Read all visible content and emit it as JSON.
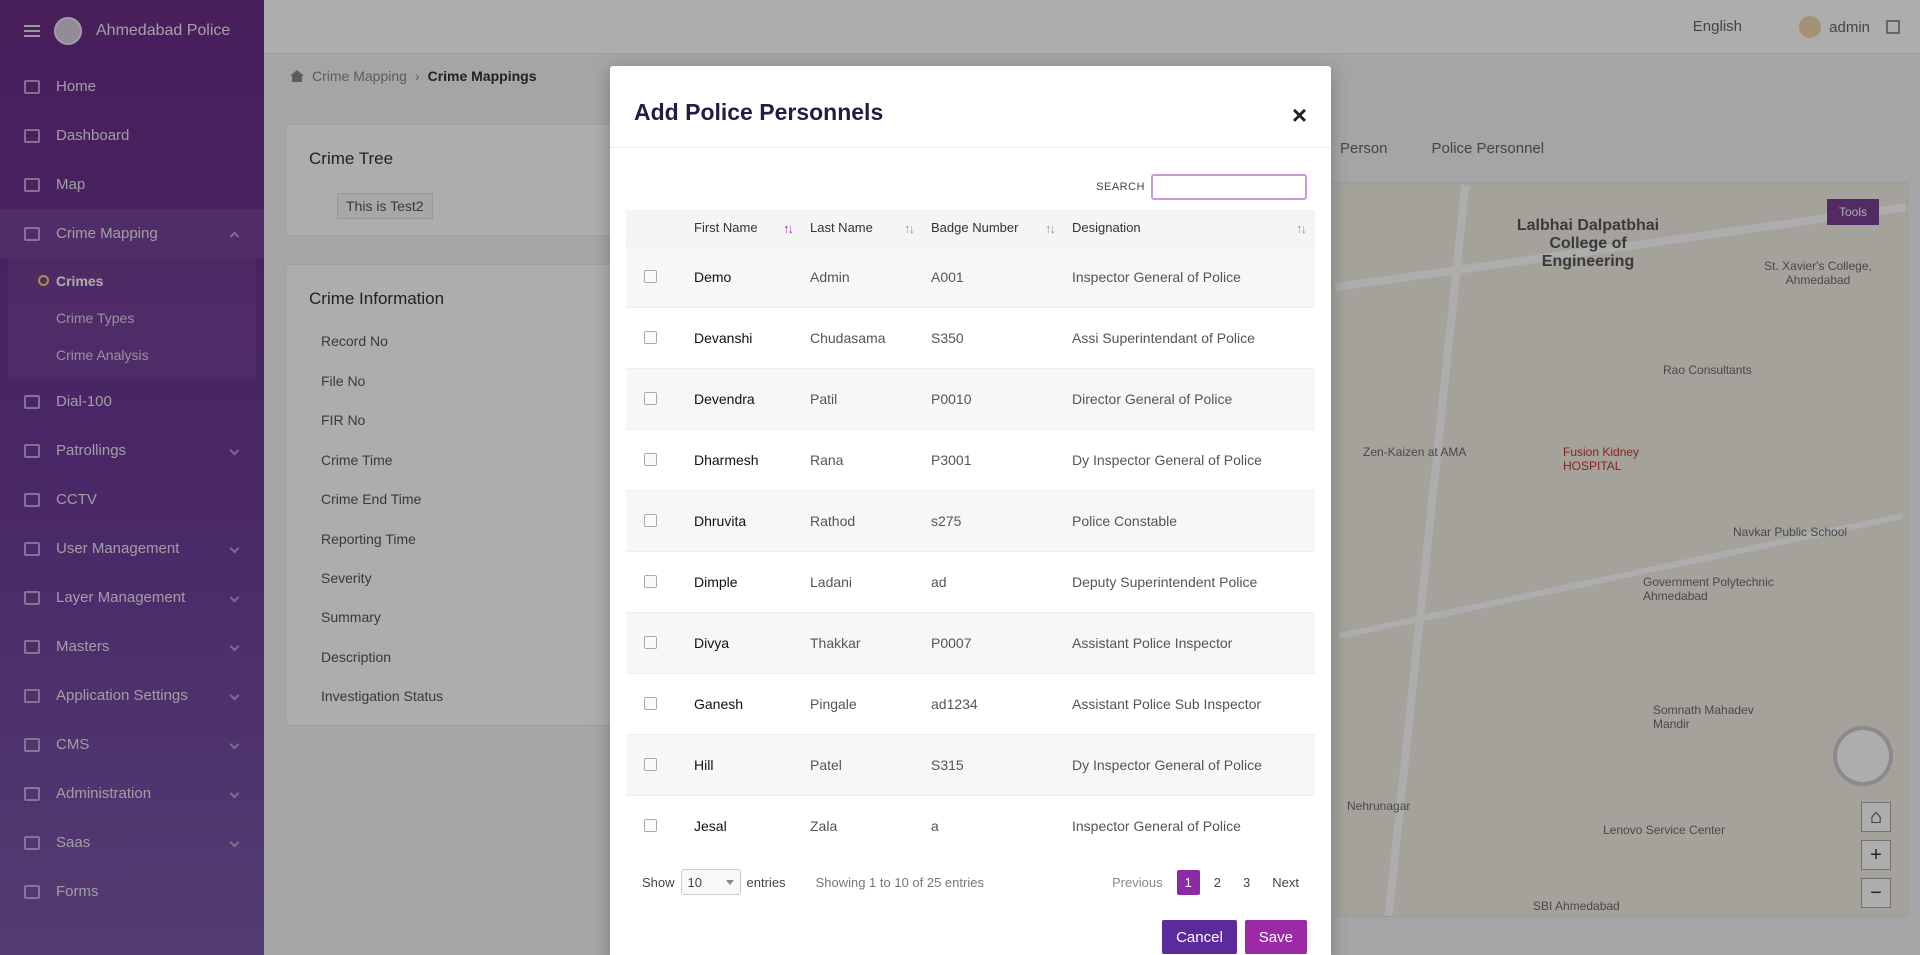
{
  "app": {
    "title": "Ahmedabad Police"
  },
  "sidebar": {
    "items": [
      {
        "label": "Home"
      },
      {
        "label": "Dashboard"
      },
      {
        "label": "Map"
      },
      {
        "label": "Crime Mapping"
      },
      {
        "label": "Dial-100"
      },
      {
        "label": "Patrollings"
      },
      {
        "label": "CCTV"
      },
      {
        "label": "User Management"
      },
      {
        "label": "Layer Management"
      },
      {
        "label": "Masters"
      },
      {
        "label": "Application Settings"
      },
      {
        "label": "CMS"
      },
      {
        "label": "Administration"
      },
      {
        "label": "Saas"
      },
      {
        "label": "Forms"
      }
    ],
    "sub_items": [
      {
        "label": "Crimes"
      },
      {
        "label": "Crime Types"
      },
      {
        "label": "Crime Analysis"
      }
    ]
  },
  "topbar": {
    "language": "English",
    "user": "admin"
  },
  "breadcrumb": {
    "parent": "Crime Mapping",
    "current": "Crime Mappings"
  },
  "crime_tree": {
    "title": "Crime Tree",
    "node": "This is Test2"
  },
  "crime_info": {
    "title": "Crime Information",
    "fields": [
      "Record No",
      "File No",
      "FIR No",
      "Crime Time",
      "Crime End Time",
      "Reporting Time",
      "Severity",
      "Summary",
      "Description",
      "Investigation Status"
    ]
  },
  "tabs": [
    "Person",
    "Police Personnel"
  ],
  "map": {
    "tools": "Tools",
    "labels": [
      "Lalbhai Dalpatbhai College of Engineering",
      "St. Xavier's College, Ahmedabad",
      "Rao Consultants",
      "Zen-Kaizen at AMA",
      "Fusion Kidney HOSPITAL",
      "Navkar Public School",
      "Government Polytechnic Ahmedabad",
      "Somnath Mahadev Mandir",
      "Nehrunagar",
      "Lenovo Service Center",
      "SBI Ahmedabad"
    ]
  },
  "modal": {
    "title": "Add Police Personnels",
    "search_label": "SEARCH",
    "columns": [
      "First Name",
      "Last Name",
      "Badge Number",
      "Designation"
    ],
    "rows": [
      {
        "first": "Demo",
        "last": "Admin",
        "badge": "A001",
        "designation": "Inspector General of Police"
      },
      {
        "first": "Devanshi",
        "last": "Chudasama",
        "badge": "S350",
        "designation": "Assi Superintendant of Police"
      },
      {
        "first": "Devendra",
        "last": "Patil",
        "badge": "P0010",
        "designation": "Director General of Police"
      },
      {
        "first": "Dharmesh",
        "last": "Rana",
        "badge": "P3001",
        "designation": "Dy Inspector General of Police"
      },
      {
        "first": "Dhruvita",
        "last": "Rathod",
        "badge": "s275",
        "designation": "Police Constable"
      },
      {
        "first": "Dimple",
        "last": "Ladani",
        "badge": "ad",
        "designation": "Deputy Superintendent Police"
      },
      {
        "first": "Divya",
        "last": "Thakkar",
        "badge": "P0007",
        "designation": "Assistant Police Inspector"
      },
      {
        "first": "Ganesh",
        "last": "Pingale",
        "badge": "ad1234",
        "designation": "Assistant Police Sub Inspector"
      },
      {
        "first": "Hill",
        "last": "Patel",
        "badge": "S315",
        "designation": "Dy Inspector General of Police"
      },
      {
        "first": "Jesal",
        "last": "Zala",
        "badge": "a",
        "designation": "Inspector General of Police"
      }
    ],
    "length_label_pre": "Show",
    "length_value": "10",
    "length_label_post": "entries",
    "info": "Showing 1 to 10 of 25 entries",
    "pager": {
      "prev": "Previous",
      "pages": [
        "1",
        "2",
        "3"
      ],
      "next": "Next"
    },
    "cancel": "Cancel",
    "save": "Save"
  }
}
